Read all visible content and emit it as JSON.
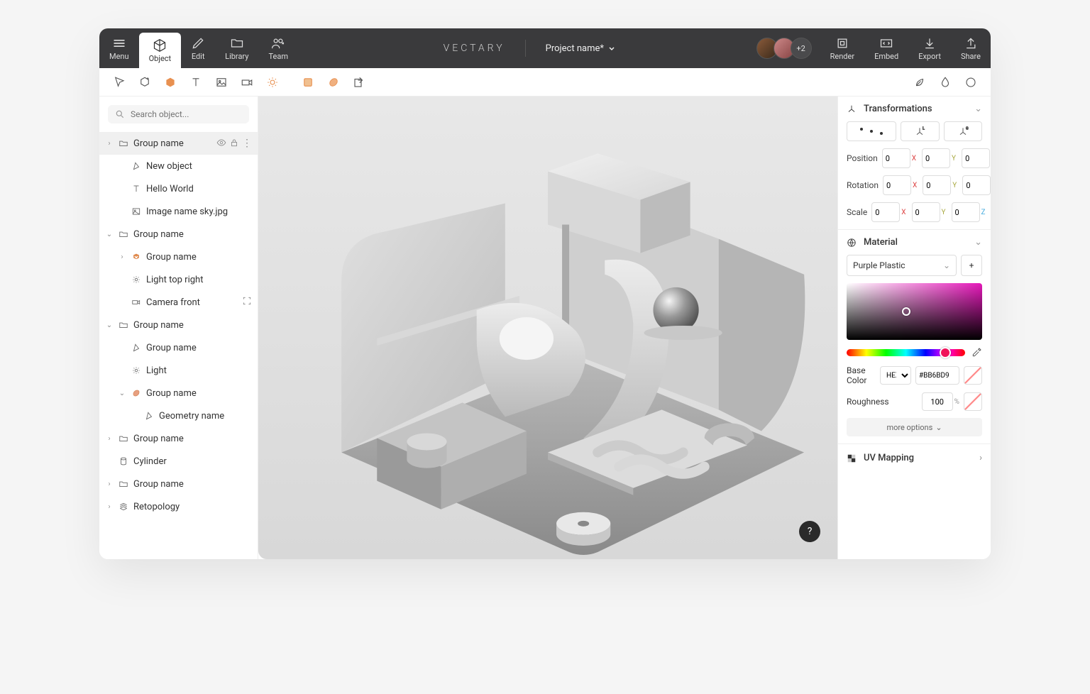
{
  "topbar": {
    "menu": "Menu",
    "object": "Object",
    "edit": "Edit",
    "library": "Library",
    "team": "Team",
    "render": "Render",
    "embed": "Embed",
    "export": "Export",
    "share": "Share",
    "brand": "VECTARY",
    "project_name": "Project name*",
    "more_users": "+2"
  },
  "search": {
    "placeholder": "Search object..."
  },
  "tree": [
    {
      "indent": 0,
      "chev": "›",
      "icon": "folder",
      "label": "Group name",
      "actions": true
    },
    {
      "indent": 1,
      "chev": "",
      "icon": "object",
      "label": "New object"
    },
    {
      "indent": 1,
      "chev": "",
      "icon": "text",
      "label": "Hello World"
    },
    {
      "indent": 1,
      "chev": "",
      "icon": "image",
      "label": "Image name sky.jpg"
    },
    {
      "indent": 0,
      "chev": "⌄",
      "icon": "folder",
      "label": "Group name"
    },
    {
      "indent": 1,
      "chev": "›",
      "icon": "mesh",
      "label": "Group name"
    },
    {
      "indent": 1,
      "chev": "",
      "icon": "light",
      "label": "Light top right"
    },
    {
      "indent": 1,
      "chev": "",
      "icon": "camera",
      "label": "Camera front",
      "target": true
    },
    {
      "indent": 0,
      "chev": "⌄",
      "icon": "folder",
      "label": "Group name"
    },
    {
      "indent": 1,
      "chev": "",
      "icon": "object",
      "label": "Group name"
    },
    {
      "indent": 1,
      "chev": "",
      "icon": "light",
      "label": "Light"
    },
    {
      "indent": 1,
      "chev": "⌄",
      "icon": "shape",
      "label": "Group name"
    },
    {
      "indent": 2,
      "chev": "",
      "icon": "object",
      "label": "Geometry name"
    },
    {
      "indent": 0,
      "chev": "›",
      "icon": "folder",
      "label": "Group name"
    },
    {
      "indent": 0,
      "chev": "",
      "icon": "cylinder",
      "label": "Cylinder"
    },
    {
      "indent": 0,
      "chev": "›",
      "icon": "folder",
      "label": "Group name"
    },
    {
      "indent": 0,
      "chev": "›",
      "icon": "retopo",
      "label": "Retopology"
    }
  ],
  "panel": {
    "transformations": "Transformations",
    "position_label": "Position",
    "rotation_label": "Rotation",
    "scale_label": "Scale",
    "position": {
      "x": "0",
      "y": "0",
      "z": "0"
    },
    "rotation": {
      "x": "0",
      "y": "0",
      "z": "0"
    },
    "scale": {
      "x": "0",
      "y": "0",
      "z": "0"
    },
    "material": "Material",
    "material_name": "Purple Plastic",
    "base_color_label": "Base Color",
    "hex_mode": "HEX",
    "hex_value": "#BB6BD9",
    "roughness_label": "Roughness",
    "roughness_value": "100",
    "more_options": "more options",
    "uv_mapping": "UV Mapping"
  },
  "help": "?"
}
